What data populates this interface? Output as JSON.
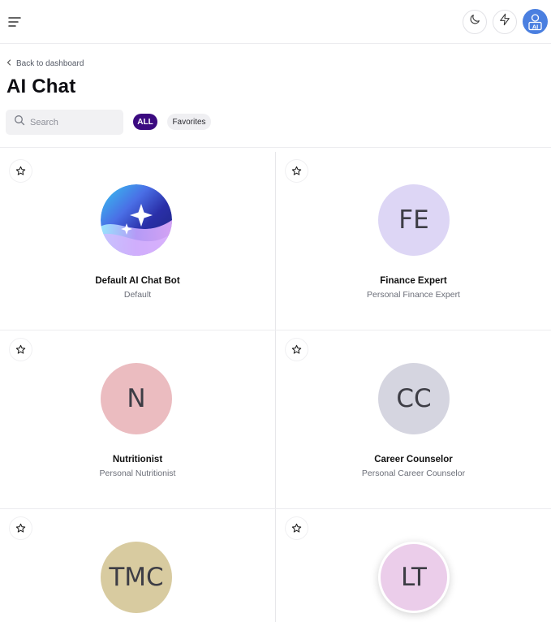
{
  "header": {
    "menu_icon": "hamburger-menu-icon",
    "theme_icon": "moon-icon",
    "bolt_icon": "lightning-icon",
    "avatar_label": "AI"
  },
  "nav": {
    "back_label": "Back to dashboard"
  },
  "page": {
    "title": "AI Chat"
  },
  "search": {
    "placeholder": "Search",
    "value": ""
  },
  "filters": {
    "all_label": "ALL",
    "favorites_label": "Favorites",
    "active": "ALL"
  },
  "bots": [
    {
      "name": "Default AI Chat Bot",
      "description": "Default",
      "initials": "",
      "avatar_type": "gradient-sparkle",
      "color": "#8a7cf0"
    },
    {
      "name": "Finance Expert",
      "description": "Personal Finance Expert",
      "initials": "FE",
      "avatar_type": "initials",
      "color": "#ddd6f5"
    },
    {
      "name": "Nutritionist",
      "description": "Personal Nutritionist",
      "initials": "N",
      "avatar_type": "initials",
      "color": "#ebbcc0"
    },
    {
      "name": "Career Counselor",
      "description": "Personal Career Counselor",
      "initials": "CC",
      "avatar_type": "initials",
      "color": "#d5d5e0"
    },
    {
      "name": "",
      "description": "",
      "initials": "TMC",
      "avatar_type": "initials",
      "color": "#d8cba0"
    },
    {
      "name": "",
      "description": "",
      "initials": "LT",
      "avatar_type": "initials",
      "color": "#ebcdea"
    }
  ],
  "colors": {
    "accent": "#3b0a80",
    "avatar_bg": "#4a7fe0"
  }
}
